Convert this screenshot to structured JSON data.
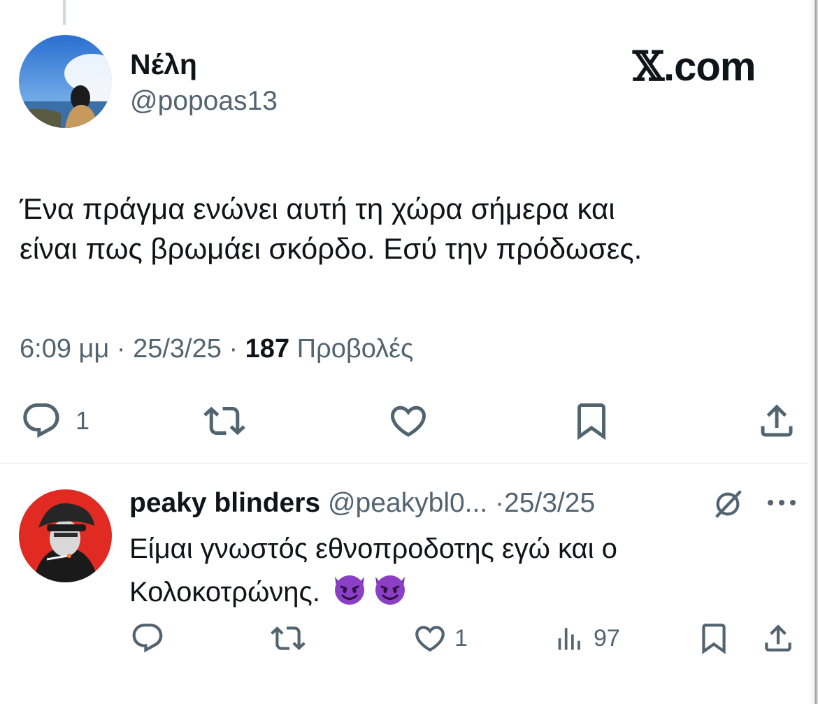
{
  "main_tweet": {
    "display_name": "Νέλη",
    "handle": "@popoas13",
    "text_line1": "Ένα πράγμα ενώνει αυτή τη χώρα σήμερα και",
    "text_line2": "είναι πως βρωμάει σκόρδο. Εσύ την πρόδωσες.",
    "time": "6:09 μμ",
    "date": "25/3/25",
    "separator": "·",
    "views_count": "187",
    "views_label": "Προβολές",
    "reply_count": "1"
  },
  "brand": {
    "x_glyph": "𝕏",
    "suffix": ".com"
  },
  "reply_tweet": {
    "display_name": "peaky blinders",
    "handle": "@peakybl0...",
    "separator": "·",
    "date": "25/3/25",
    "text_line1": "Είμαι γνωστός εθνοπροδοτης εγώ και ο",
    "text_line2": "Κολοκοτρώνης.",
    "emoji_names": [
      "smiling-devil-icon",
      "smiling-devil-icon"
    ],
    "like_count": "1",
    "views_count": "97"
  },
  "colors": {
    "text": "#0f1419",
    "secondary": "#536471",
    "divider": "#eff3f4",
    "devil": "#8b3fc4"
  }
}
